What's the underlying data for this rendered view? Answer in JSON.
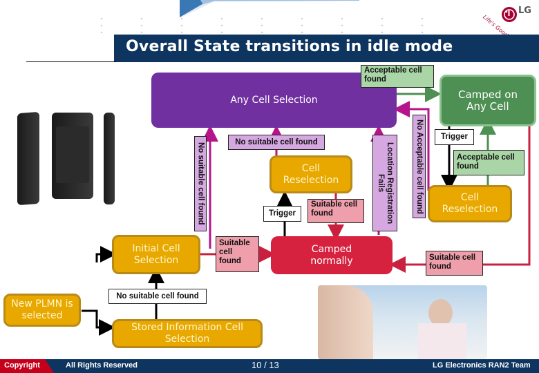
{
  "slide": {
    "title": "Overall State transitions in idle mode",
    "logo": {
      "brand": "LG",
      "slogan": "Life's Good"
    }
  },
  "states": {
    "any_cell_selection": "Any Cell Selection",
    "camped_on_any_cell": "Camped on Any Cell",
    "cell_reselection_left": "Cell Reselection",
    "cell_reselection_right": "Cell Reselection",
    "initial_cell_selection": "Initial Cell Selection",
    "camped_normally": "Camped normally",
    "new_plmn": "New PLMN is selected",
    "stored_info_selection": "Stored Information Cell Selection"
  },
  "labels": {
    "acceptable_found_top": "Acceptable cell found",
    "no_suitable_left": "No suitable cell found",
    "no_suitable_mid": "No suitable cell found",
    "location_reg_fails": "Location Registration Fails",
    "no_acceptable": "No Acceptable cell found",
    "trigger_mid": "Trigger",
    "suitable_found_mid": "Suitable cell found",
    "trigger_right": "Trigger",
    "acceptable_found_right": "Acceptable cell found",
    "suitable_found_initial": "Suitable cell found",
    "suitable_found_right": "Suitable cell found",
    "no_suitable_bottom": "No suitable cell found"
  },
  "footer": {
    "copyright": "Copyright",
    "rights": "All Rights Reserved",
    "page": "10 / 13",
    "team": "LG Electronics RAN2 Team"
  },
  "colors": {
    "title_bar": "#0e3560",
    "any_cell": "#7030a0",
    "camped_any": "#4e8f54",
    "reselection": "#e8a800",
    "camped_normally": "#d6213f",
    "footer_red": "#c4001a"
  }
}
